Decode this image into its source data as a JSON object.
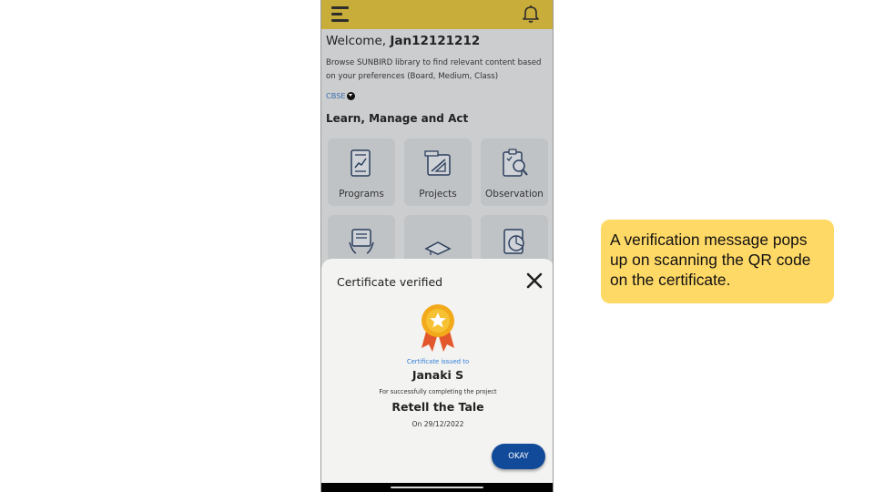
{
  "app": {
    "welcome_prefix": "Welcome, ",
    "username": "Jan12121212",
    "browse_text": "Browse SUNBIRD library to find relevant content based on your preferences (Board, Medium, Class)",
    "board": "CBSE",
    "section_title": "Learn, Manage and Act",
    "tiles": [
      {
        "label": "Programs",
        "icon": "programs-icon"
      },
      {
        "label": "Projects",
        "icon": "projects-icon"
      },
      {
        "label": "Observation",
        "icon": "observation-icon"
      },
      {
        "label": "",
        "icon": "survey-icon"
      },
      {
        "label": "",
        "icon": "graduation-cap-icon"
      },
      {
        "label": "",
        "icon": "report-icon"
      }
    ],
    "colors": {
      "header": "#c9ad3a",
      "button": "#124a9a",
      "link": "#2f7ed8"
    }
  },
  "dialog": {
    "title": "Certificate verified",
    "issued_to_label": "Certificate issued to",
    "recipient": "Janaki S",
    "completion_text": "For successfully completing the project",
    "project_name": "Retell the Tale",
    "date": "On 29/12/2022",
    "ok_label": "OKAY",
    "icon": "medal-icon"
  },
  "callout": {
    "text": "A verification message pops up on scanning the QR code on the certificate."
  }
}
